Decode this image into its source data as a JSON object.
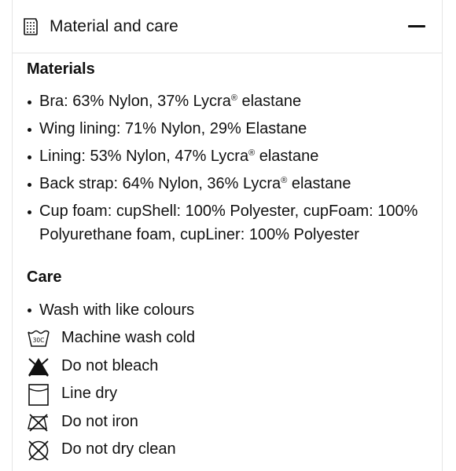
{
  "accordion": {
    "title": "Material and care",
    "header_icon": "fabric-tag-icon",
    "toggle_icon": "minus-icon"
  },
  "materials": {
    "heading": "Materials",
    "items": [
      {
        "text": "Bra: 63% Nylon, 37% Lycra",
        "sup": "®",
        "tail": " elastane"
      },
      {
        "text": "Wing lining: 71% Nylon, 29% Elastane",
        "sup": "",
        "tail": ""
      },
      {
        "text": "Lining: 53% Nylon, 47% Lycra",
        "sup": "®",
        "tail": " elastane"
      },
      {
        "text": "Back strap: 64% Nylon, 36% Lycra",
        "sup": "®",
        "tail": " elastane"
      },
      {
        "text": "Cup foam: cupShell: 100% Polyester, cupFoam: 100% Polyurethane foam, cupLiner: 100% Polyester",
        "sup": "",
        "tail": ""
      }
    ]
  },
  "care": {
    "heading": "Care",
    "items": [
      {
        "label": "Wash with like colours",
        "icon": "bullet"
      },
      {
        "label": "Machine wash cold",
        "icon": "wash-30c-icon",
        "icon_text": "30C"
      },
      {
        "label": "Do not bleach",
        "icon": "no-bleach-icon"
      },
      {
        "label": "Line dry",
        "icon": "line-dry-icon"
      },
      {
        "label": "Do not iron",
        "icon": "no-iron-icon"
      },
      {
        "label": "Do not dry clean",
        "icon": "no-dry-clean-icon"
      }
    ]
  }
}
